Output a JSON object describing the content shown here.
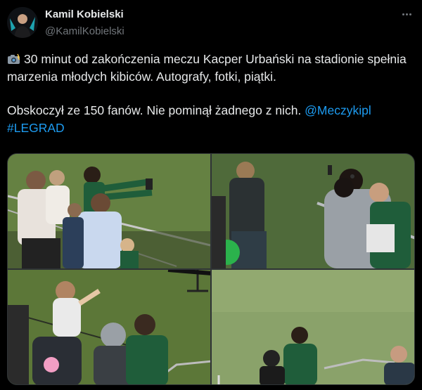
{
  "author": {
    "name": "Kamil Kobielski",
    "handle": "@KamilKobielski"
  },
  "more_icon": "more-horizontal-icon",
  "tweet": {
    "emoji_icon": "camera-flash-icon",
    "line1": "30 minut od zakończenia meczu Kacper Urbański na stadionie spełnia marzenia młodych kibiców. Autografy, fotki, piątki.",
    "line2_text": "Obskoczył ze 150 fanów. Nie pominął żadnego z nich. ",
    "mention": "@Meczykipl",
    "hashtag": "#LEGRAD"
  },
  "media": {
    "count": 4,
    "colors": {
      "pitch": "#5f7a3f",
      "kit": "#1f5d3a",
      "accent": "#1d9bf0"
    }
  }
}
